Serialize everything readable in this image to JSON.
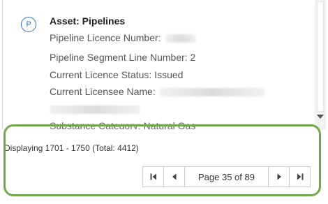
{
  "popup": {
    "badge_letter": "P",
    "asset_title": "Asset: Pipelines",
    "attributes": {
      "licence_number_label": "Pipeline Licence Number:",
      "segment_line_label": "Pipeline Segment Line Number: 2",
      "status_label": "Current Licence Status: Issued",
      "licensee_label": "Current Licensee Name:",
      "substance_label": "Substance Category: Natural Gas"
    }
  },
  "pager": {
    "display_info": "Displaying 1701 - 1750 (Total: 4412)",
    "page_label": "Page 35 of 89",
    "icons": {
      "first": "first-page-icon",
      "prev": "prev-page-icon",
      "next": "next-page-icon",
      "last": "last-page-icon"
    }
  },
  "colors": {
    "highlight": "#72a84b",
    "badge": "#2f6fb6"
  }
}
